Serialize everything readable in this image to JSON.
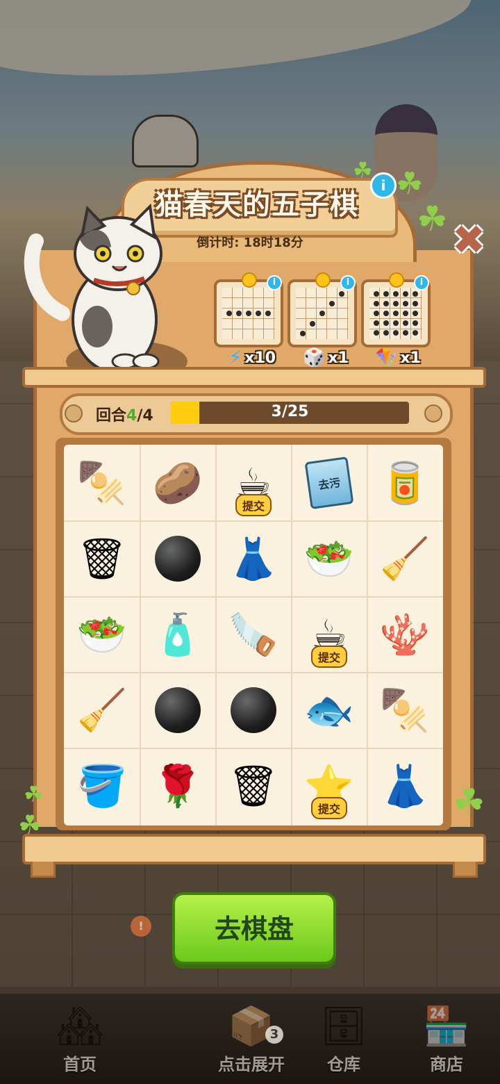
{
  "event": {
    "title": "猫春天的五子棋",
    "countdown": "倒计时: 18时18分"
  },
  "goals": [
    {
      "pattern": "horizontal-line",
      "reward_icon": "lightning-icon",
      "reward_count": "x10"
    },
    {
      "pattern": "diagonal-line",
      "reward_icon": "dice-icon",
      "reward_count": "x1"
    },
    {
      "pattern": "full-grid",
      "reward_icon": "propeller-icon",
      "reward_count": "x1"
    }
  ],
  "round": {
    "label": "回合",
    "current": "4",
    "separator": "/",
    "total": "4",
    "progress_text": "3/25",
    "progress_fraction": 0.12
  },
  "board": {
    "submit_label": "提交",
    "cells": [
      {
        "icon": "🍢",
        "name": "grilled-fish-plate"
      },
      {
        "icon": "🥔",
        "name": "potato-chips"
      },
      {
        "icon": "☕",
        "name": "coffee-cup",
        "submit": true
      },
      {
        "icon": "去污",
        "name": "detergent-bag",
        "text": true
      },
      {
        "icon": "🥫",
        "name": "paint-cans"
      },
      {
        "icon": "🗑",
        "name": "grill-bin"
      },
      {
        "icon": "",
        "name": "black-stone",
        "stone": true
      },
      {
        "icon": "👗",
        "name": "apron"
      },
      {
        "icon": "🥗",
        "name": "fruit-bowl"
      },
      {
        "icon": "🧹",
        "name": "pink-mop"
      },
      {
        "icon": "🥗",
        "name": "fruit-bowl"
      },
      {
        "icon": "🧴",
        "name": "lime-jug"
      },
      {
        "icon": "🪚",
        "name": "saw"
      },
      {
        "icon": "☕",
        "name": "coffee-cup",
        "submit": true
      },
      {
        "icon": "🪸",
        "name": "coral-plant"
      },
      {
        "icon": "🧹",
        "name": "rake"
      },
      {
        "icon": "",
        "name": "black-stone",
        "stone": true
      },
      {
        "icon": "",
        "name": "black-stone",
        "stone": true
      },
      {
        "icon": "🐟",
        "name": "blue-fish"
      },
      {
        "icon": "🍢",
        "name": "skewers-plate"
      },
      {
        "icon": "🪣",
        "name": "pink-bucket"
      },
      {
        "icon": "🌹",
        "name": "rose-pot"
      },
      {
        "icon": "🗑",
        "name": "grill-bin"
      },
      {
        "icon": "⭐",
        "name": "starfish",
        "submit": true
      },
      {
        "icon": "👗",
        "name": "teal-dress"
      }
    ]
  },
  "go_button": {
    "label": "去棋盘"
  },
  "nav": {
    "home": "首页",
    "expand": "点击展开",
    "expand_badge": "3",
    "storage": "仓库",
    "shop": "商店"
  },
  "colors": {
    "accent_green": "#6bc91a",
    "progress_yellow": "#ffcc10",
    "wood": "#e0a96a"
  }
}
